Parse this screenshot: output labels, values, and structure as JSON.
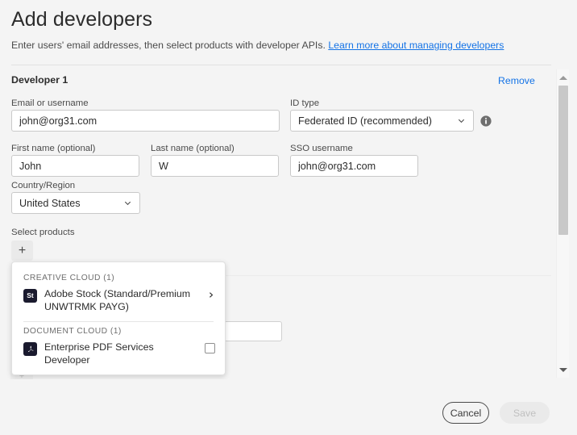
{
  "page": {
    "title": "Add developers",
    "subtitle_text": "Enter users' email addresses, then select products with developer APIs.",
    "subtitle_link": "Learn more about managing developers",
    "accent_link_color": "#1473E6",
    "background_color": "#F4F4F4"
  },
  "developer_section": {
    "label": "Developer 1",
    "remove_label": "Remove"
  },
  "form": {
    "email": {
      "label": "Email or username",
      "value": "john@org31.com",
      "placeholder": ""
    },
    "id_type": {
      "label": "ID type",
      "value": "Federated ID (recommended)",
      "info_icon": "info-circle-icon",
      "chevron_icon": "chevron-down-icon"
    },
    "first_name": {
      "label": "First name (optional)",
      "value": "John",
      "placeholder": ""
    },
    "last_name": {
      "label": "Last name (optional)",
      "value": "W",
      "placeholder": ""
    },
    "sso_username": {
      "label": "SSO username",
      "value": "john@org31.com",
      "placeholder": ""
    },
    "country": {
      "label": "Country/Region",
      "value": "United States",
      "chevron_icon": "chevron-down-icon"
    },
    "select_products": {
      "label": "Select products",
      "add_button_icon": "plus-icon",
      "add_button_label": "+"
    },
    "add_developer_button_label": "+"
  },
  "product_popup": {
    "groups": [
      {
        "header": "CREATIVE CLOUD (1)",
        "items": [
          {
            "name": "Adobe Stock (Standard/Premium UNWTRMK PAYG)",
            "icon_label": "St",
            "icon_color": "#1A1A2E",
            "icon_name": "adobe-stock-icon",
            "trailing": "chevron-right-icon",
            "checked": false
          }
        ]
      },
      {
        "header": "DOCUMENT CLOUD (1)",
        "items": [
          {
            "name": "Enterprise PDF Services Developer",
            "icon_label": "A",
            "icon_color": "#1A1A2E",
            "icon_name": "acrobat-icon",
            "trailing": "checkbox",
            "checked": false
          }
        ]
      }
    ]
  },
  "scrollbar": {
    "up_icon": "triangle-up-icon",
    "down_icon": "triangle-down-icon"
  },
  "footer": {
    "cancel_label": "Cancel",
    "save_label": "Save",
    "save_disabled": true
  }
}
